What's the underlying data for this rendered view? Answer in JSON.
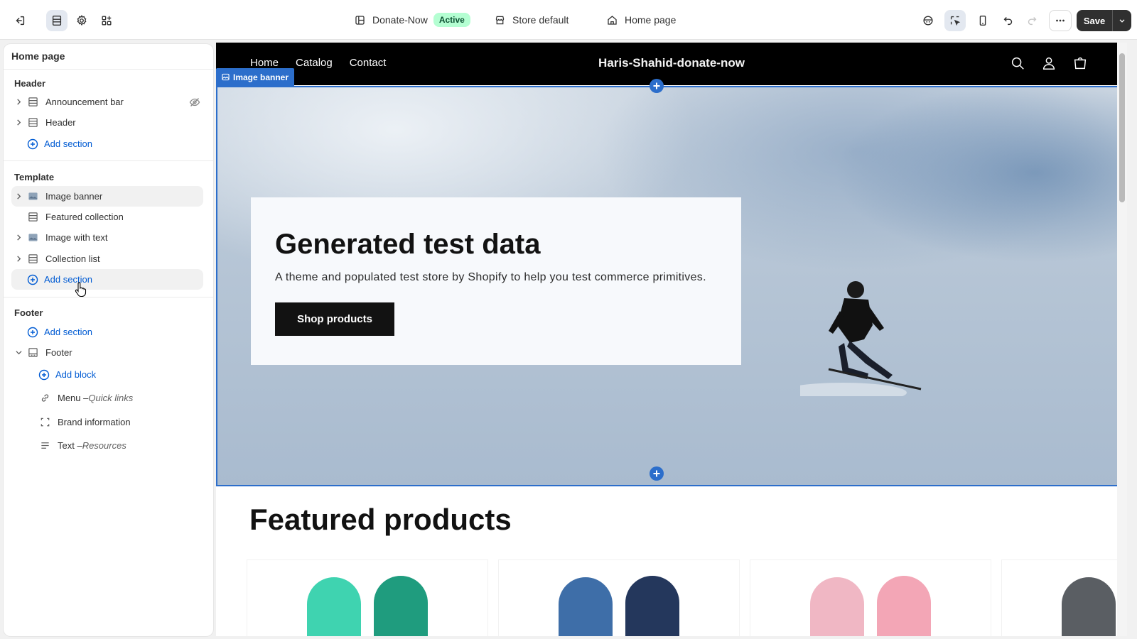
{
  "topbar": {
    "theme_name": "Donate-Now",
    "theme_status": "Active",
    "store": "Store default",
    "page": "Home page",
    "save_label": "Save"
  },
  "sidebar": {
    "title": "Home page",
    "header_group": {
      "heading": "Header",
      "items": [
        {
          "label": "Announcement bar",
          "hidden": true
        },
        {
          "label": "Header"
        }
      ],
      "add_label": "Add section"
    },
    "template_group": {
      "heading": "Template",
      "items": [
        {
          "label": "Image banner"
        },
        {
          "label": "Featured collection"
        },
        {
          "label": "Image with text"
        },
        {
          "label": "Collection list"
        }
      ],
      "add_label": "Add section"
    },
    "footer_group": {
      "heading": "Footer",
      "add_label": "Add section",
      "footer_label": "Footer",
      "add_block_label": "Add block",
      "blocks": [
        {
          "label": "Menu – ",
          "detail": "Quick links"
        },
        {
          "label": "Brand information",
          "detail": ""
        },
        {
          "label": "Text – ",
          "detail": "Resources"
        }
      ]
    }
  },
  "preview": {
    "nav": [
      "Home",
      "Catalog",
      "Contact"
    ],
    "brand": "Haris-Shahid-donate-now",
    "selection_tag": "Image banner",
    "banner": {
      "heading": "Generated test data",
      "text": "A theme and populated test store by Shopify to help you test commerce primitives.",
      "button": "Shop products"
    },
    "featured_title": "Featured products"
  },
  "colors": {
    "accent": "#005bd3",
    "selection": "#2c6ecb",
    "active_badge_bg": "#b4fed2",
    "save_bg": "#303030"
  }
}
